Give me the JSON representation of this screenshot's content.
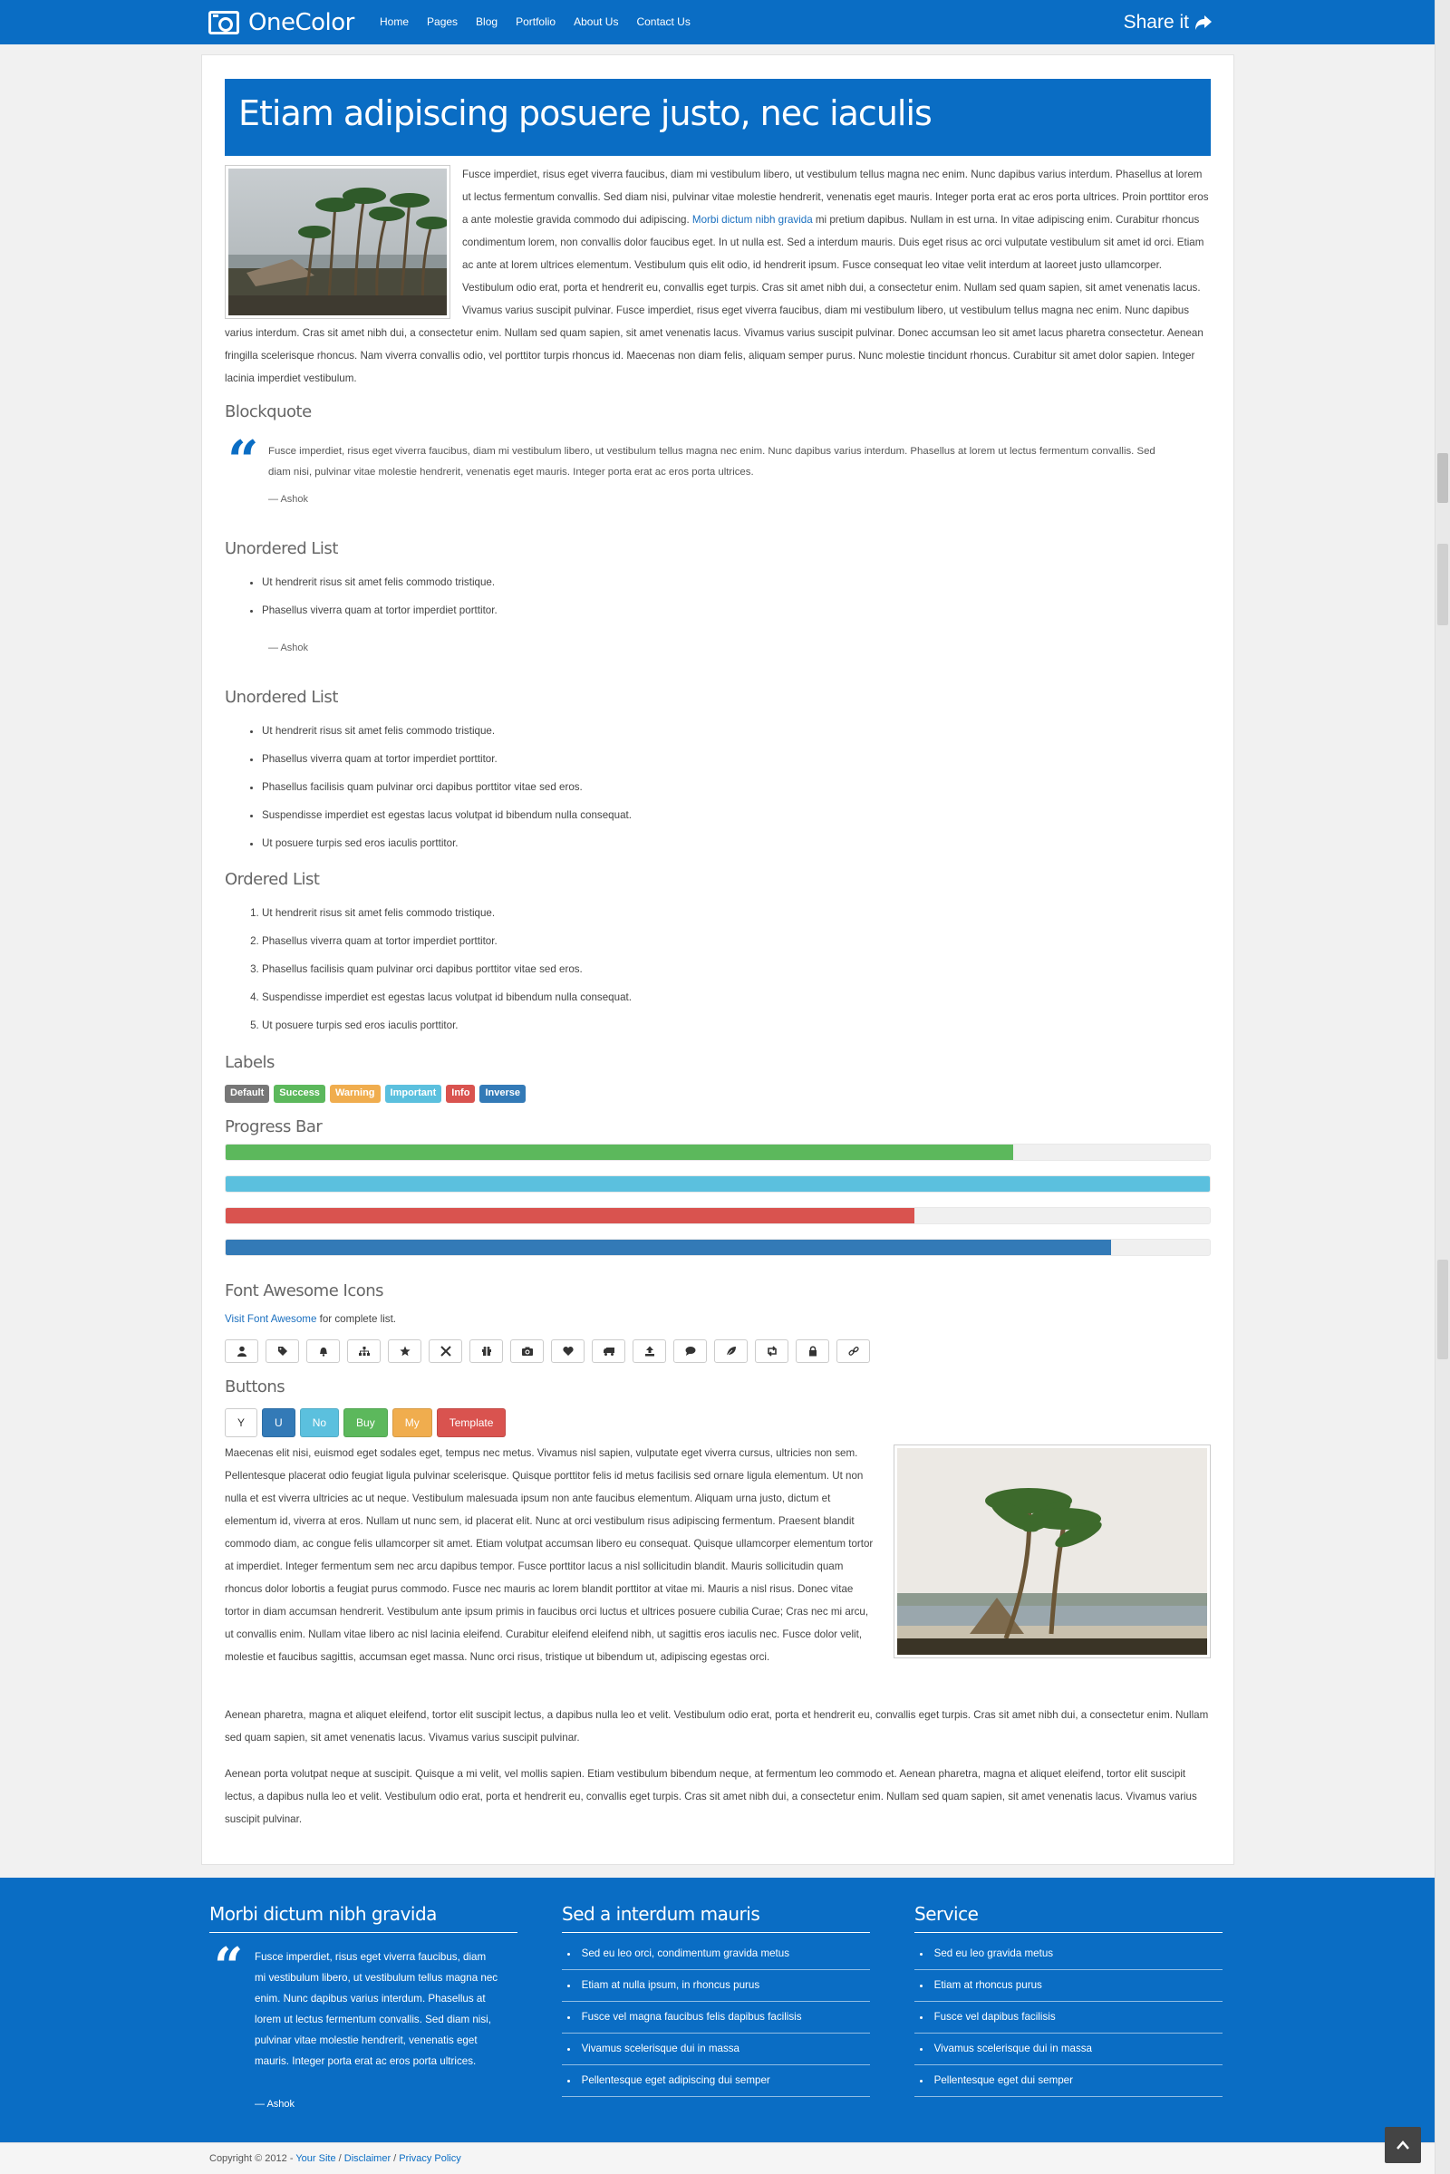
{
  "header": {
    "brand": "OneColor",
    "nav": [
      "Home",
      "Pages",
      "Blog",
      "Portfolio",
      "About Us",
      "Contact Us"
    ],
    "share": "Share it"
  },
  "article": {
    "title": "Etiam adipiscing posuere justo, nec iaculis",
    "intro_before_link": "Fusce imperdiet, risus eget viverra faucibus, diam mi vestibulum libero, ut vestibulum tellus magna nec enim. Nunc dapibus varius interdum. Phasellus at lorem ut lectus fermentum convallis. Sed diam nisi, pulvinar vitae molestie hendrerit, venenatis eget mauris. Integer porta erat ac eros porta ultrices. Proin porttitor eros a ante molestie gravida commodo dui adipiscing. ",
    "intro_link": "Morbi dictum nibh gravida",
    "intro_after_link": " mi pretium dapibus. Nullam in est urna. In vitae adipiscing enim. Curabitur rhoncus condimentum lorem, non convallis dolor faucibus eget. In ut nulla est. Sed a interdum mauris. Duis eget risus ac orci vulputate vestibulum sit amet id orci. Etiam ac ante at lorem ultrices elementum. Vestibulum quis elit odio, id hendrerit ipsum. Fusce consequat leo vitae velit interdum at laoreet justo ullamcorper. Vestibulum odio erat, porta et hendrerit eu, convallis eget turpis. Cras sit amet nibh dui, a consectetur enim. Nullam sed quam sapien, sit amet venenatis lacus. Vivamus varius suscipit pulvinar. Fusce imperdiet, risus eget viverra faucibus, diam mi vestibulum libero, ut vestibulum tellus magna nec enim. Nunc dapibus varius interdum. Cras sit amet nibh dui, a consectetur enim. Nullam sed quam sapien, sit amet venenatis lacus. Vivamus varius suscipit pulvinar. Donec accumsan leo sit amet lacus pharetra consectetur. Aenean fringilla scelerisque rhoncus. Nam viverra convallis odio, vel porttitor turpis rhoncus id. Maecenas non diam felis, aliquam semper purus. Nunc molestie tincidunt rhoncus. Curabitur sit amet dolor sapien. Integer lacinia imperdiet vestibulum.",
    "blockquote_heading": "Blockquote",
    "blockquote_text": "Fusce imperdiet, risus eget viverra faucibus, diam mi vestibulum libero, ut vestibulum tellus magna nec enim. Nunc dapibus varius interdum. Phasellus at lorem ut lectus fermentum convallis. Sed diam nisi, pulvinar vitae molestie hendrerit, venenatis eget mauris. Integer porta erat ac eros porta ultrices.",
    "blockquote_cite": "— Ashok",
    "ul1_heading": "Unordered List",
    "ul1_items": [
      "Ut hendrerit risus sit amet felis commodo tristique.",
      "Phasellus viverra quam at tortor imperdiet porttitor."
    ],
    "ul1_cite": "— Ashok",
    "ul2_heading": "Unordered List",
    "ul2_items": [
      "Ut hendrerit risus sit amet felis commodo tristique.",
      "Phasellus viverra quam at tortor imperdiet porttitor.",
      "Phasellus facilisis quam pulvinar orci dapibus porttitor vitae sed eros.",
      "Suspendisse imperdiet est egestas lacus volutpat id bibendum nulla consequat.",
      "Ut posuere turpis sed eros iaculis porttitor."
    ],
    "ol_heading": "Ordered List",
    "ol_items": [
      "Ut hendrerit risus sit amet felis commodo tristique.",
      "Phasellus viverra quam at tortor imperdiet porttitor.",
      "Phasellus facilisis quam pulvinar orci dapibus porttitor vitae sed eros.",
      "Suspendisse imperdiet est egestas lacus volutpat id bibendum nulla consequat.",
      "Ut posuere turpis sed eros iaculis porttitor."
    ],
    "labels_heading": "Labels",
    "labels": [
      {
        "text": "Default",
        "color": "#777777"
      },
      {
        "text": "Success",
        "color": "#5cb85c"
      },
      {
        "text": "Warning",
        "color": "#f0ad4e"
      },
      {
        "text": "Important",
        "color": "#5bc0de"
      },
      {
        "text": "Info",
        "color": "#d9534f"
      },
      {
        "text": "Inverse",
        "color": "#337ab7"
      }
    ],
    "progress_heading": "Progress Bar",
    "progress": [
      {
        "fraction": 0.8,
        "color": "#5cb85c"
      },
      {
        "fraction": 1.0,
        "color": "#5bc0de"
      },
      {
        "fraction": 0.7,
        "color": "#d9534f"
      },
      {
        "fraction": 0.9,
        "color": "#337ab7"
      }
    ],
    "icons_heading": "Font Awesome Icons",
    "icons_link": "Visit Font Awesome",
    "icons_after": " for complete list.",
    "icons": [
      "user-icon",
      "tag-icon",
      "bell-icon",
      "sitemap-icon",
      "star-icon",
      "plane-icon",
      "gift-icon",
      "camera-icon",
      "heart-icon",
      "truck-icon",
      "upload-icon",
      "comment-icon",
      "leaf-icon",
      "retweet-icon",
      "lock-icon",
      "link-icon"
    ],
    "buttons_heading": "Buttons",
    "buttons": [
      {
        "text": "Y",
        "color": "#ffffff",
        "fg": "#333333"
      },
      {
        "text": "U",
        "color": "#337ab7",
        "fg": "#ffffff"
      },
      {
        "text": "No",
        "color": "#5bc0de",
        "fg": "#ffffff"
      },
      {
        "text": "Buy",
        "color": "#5cb85c",
        "fg": "#ffffff"
      },
      {
        "text": "My",
        "color": "#f0ad4e",
        "fg": "#ffffff"
      },
      {
        "text": "Template",
        "color": "#d9534f",
        "fg": "#ffffff"
      }
    ],
    "para2": "Maecenas elit nisi, euismod eget sodales eget, tempus nec metus. Vivamus nisl sapien, vulputate eget viverra cursus, ultricies non sem. Pellentesque placerat odio feugiat ligula pulvinar scelerisque. Quisque porttitor felis id metus facilisis sed ornare ligula elementum. Ut non nulla et est viverra ultricies ac ut neque. Vestibulum malesuada ipsum non ante faucibus elementum. Aliquam urna justo, dictum et elementum id, viverra at eros. Nullam ut nunc sem, id placerat elit. Nunc at orci vestibulum risus adipiscing fermentum. Praesent blandit commodo diam, ac congue felis ullamcorper sit amet. Etiam volutpat accumsan libero eu consequat. Quisque ullamcorper elementum tortor at imperdiet. Integer fermentum sem nec arcu dapibus tempor. Fusce porttitor lacus a nisl sollicitudin blandit. Mauris sollicitudin quam rhoncus dolor lobortis a feugiat purus commodo. Fusce nec mauris ac lorem blandit porttitor at vitae mi. Mauris a nisl risus. Donec vitae tortor in diam accumsan hendrerit. Vestibulum ante ipsum primis in faucibus orci luctus et ultrices posuere cubilia Curae; Cras nec mi arcu, ut convallis enim. Nullam vitae libero ac nisl lacinia eleifend. Curabitur eleifend eleifend nibh, ut sagittis eros iaculis nec. Fusce dolor velit, molestie et faucibus sagittis, accumsan eget massa. Nunc orci risus, tristique ut bibendum ut, adipiscing egestas orci.",
    "para3": "Aenean pharetra, magna et aliquet eleifend, tortor elit suscipit lectus, a dapibus nulla leo et velit. Vestibulum odio erat, porta et hendrerit eu, convallis eget turpis. Cras sit amet nibh dui, a consectetur enim. Nullam sed quam sapien, sit amet venenatis lacus. Vivamus varius suscipit pulvinar.",
    "para4": "Aenean porta volutpat neque at suscipit. Quisque a mi velit, vel mollis sapien. Etiam vestibulum bibendum neque, at fermentum leo commodo et. Aenean pharetra, magna et aliquet eleifend, tortor elit suscipit lectus, a dapibus nulla leo et velit. Vestibulum odio erat, porta et hendrerit eu, convallis eget turpis. Cras sit amet nibh dui, a consectetur enim. Nullam sed quam sapien, sit amet venenatis lacus. Vivamus varius suscipit pulvinar."
  },
  "footer": {
    "col1_title": "Morbi dictum nibh gravida",
    "col1_quote": "Fusce imperdiet, risus eget viverra faucibus, diam mi vestibulum libero, ut vestibulum tellus magna nec enim. Nunc dapibus varius interdum. Phasellus at lorem ut lectus fermentum convallis. Sed diam nisi, pulvinar vitae molestie hendrerit, venenatis eget mauris. Integer porta erat ac eros porta ultrices.",
    "col1_cite": "— Ashok",
    "col2_title": "Sed a interdum mauris",
    "col2_items": [
      "Sed eu leo orci, condimentum gravida metus",
      "Etiam at nulla ipsum, in rhoncus purus",
      "Fusce vel magna faucibus felis dapibus facilisis",
      "Vivamus scelerisque dui in massa",
      "Pellentesque eget adipiscing dui semper"
    ],
    "col3_title": "Service",
    "col3_items": [
      "Sed eu leo gravida metus",
      "Etiam at rhoncus purus",
      "Fusce vel dapibus facilisis",
      "Vivamus scelerisque dui in massa",
      "Pellentesque eget dui semper"
    ]
  },
  "bottom": {
    "copyright": "Copyright © 2012 - ",
    "your_site": "Your Site",
    "sep1": " / ",
    "disclaimer": "Disclaimer",
    "sep2": " / ",
    "privacy": "Privacy Policy"
  },
  "colors": {
    "brand": "#0a6dc4"
  }
}
